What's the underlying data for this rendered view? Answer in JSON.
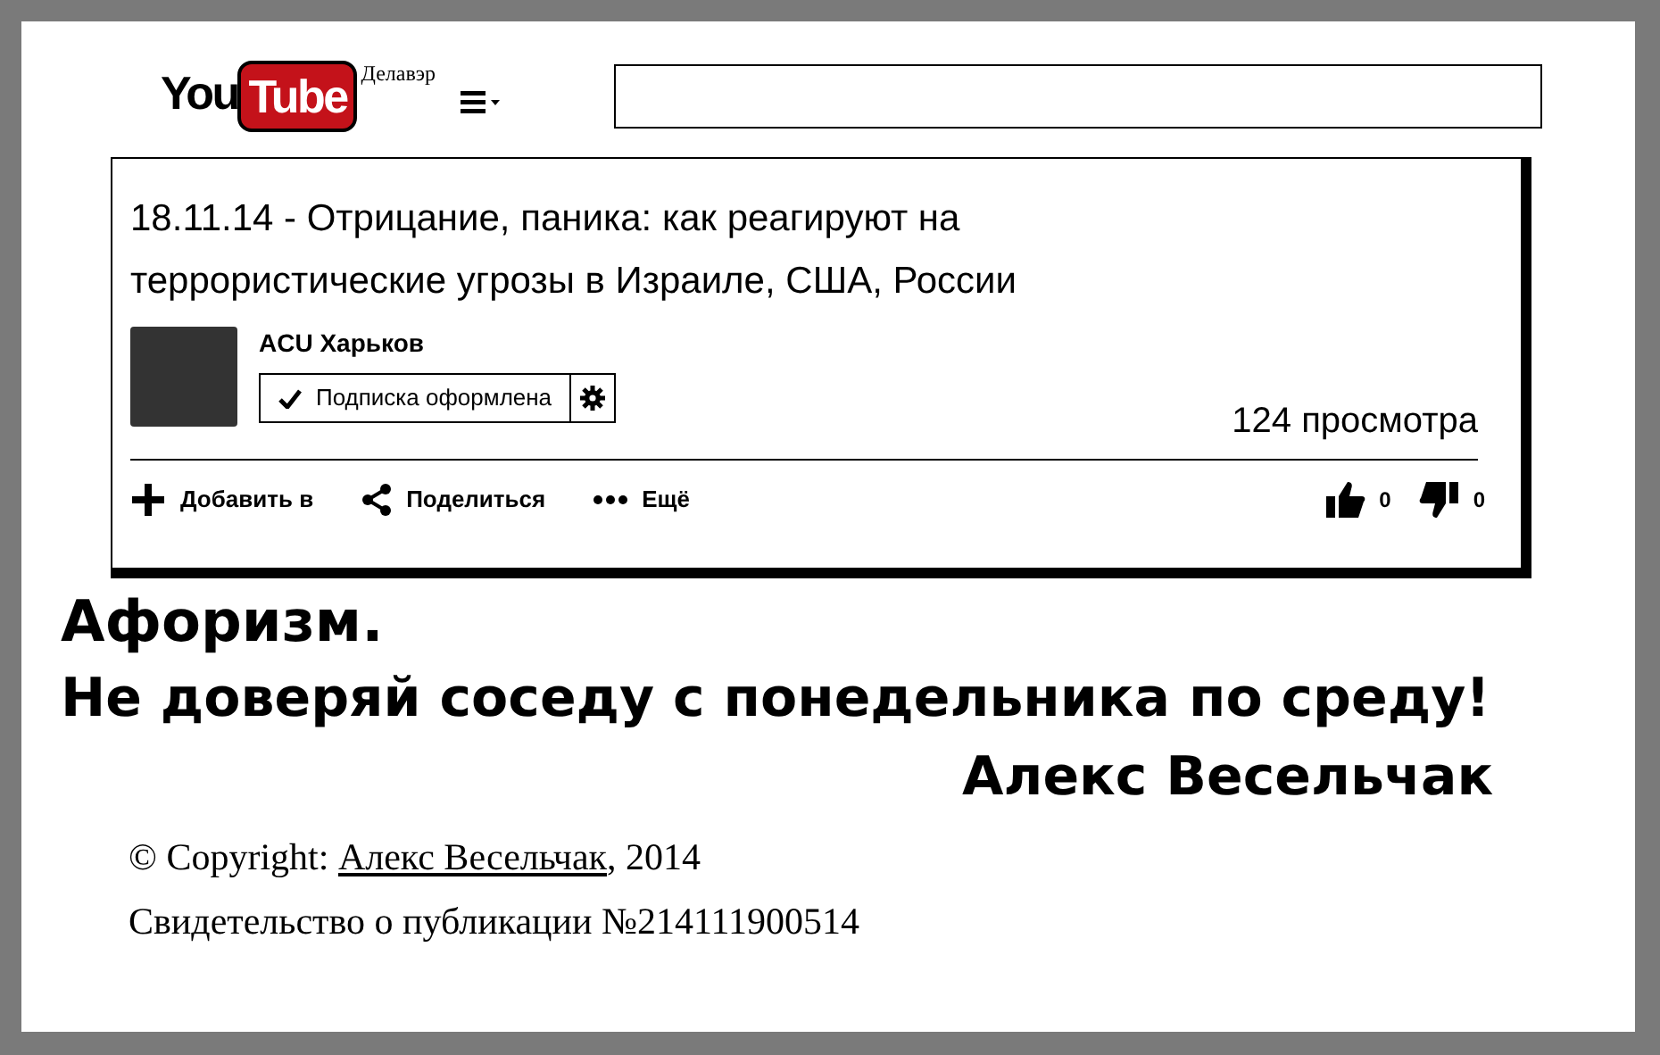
{
  "header": {
    "logo_you": "You",
    "logo_tube": "Tube",
    "region": "Делавэр"
  },
  "video": {
    "title": "18.11.14 - Отрицание, паника: как реагируют на террористические угрозы в Израиле, США, России",
    "channel": "ACU Харьков",
    "subscribe_label": "Подписка оформлена",
    "subscribed": true,
    "views": "124 просмотра",
    "actions": [
      {
        "kind": "add",
        "label": "Добавить в"
      },
      {
        "kind": "share",
        "label": "Поделиться"
      },
      {
        "kind": "more",
        "label": "Ещё"
      }
    ],
    "likes": "0",
    "dislikes": "0"
  },
  "aphorism": {
    "heading": "Афоризм.",
    "text": "Не доверяй соседу с понедельника по среду!",
    "author": "Алекс Весельчак"
  },
  "footer": {
    "copyright_prefix": "© Copyright: ",
    "author_link": "Алекс Весельчак",
    "copyright_suffix": ", 2014",
    "certificate": "Свидетельство о публикации №214111900514"
  }
}
